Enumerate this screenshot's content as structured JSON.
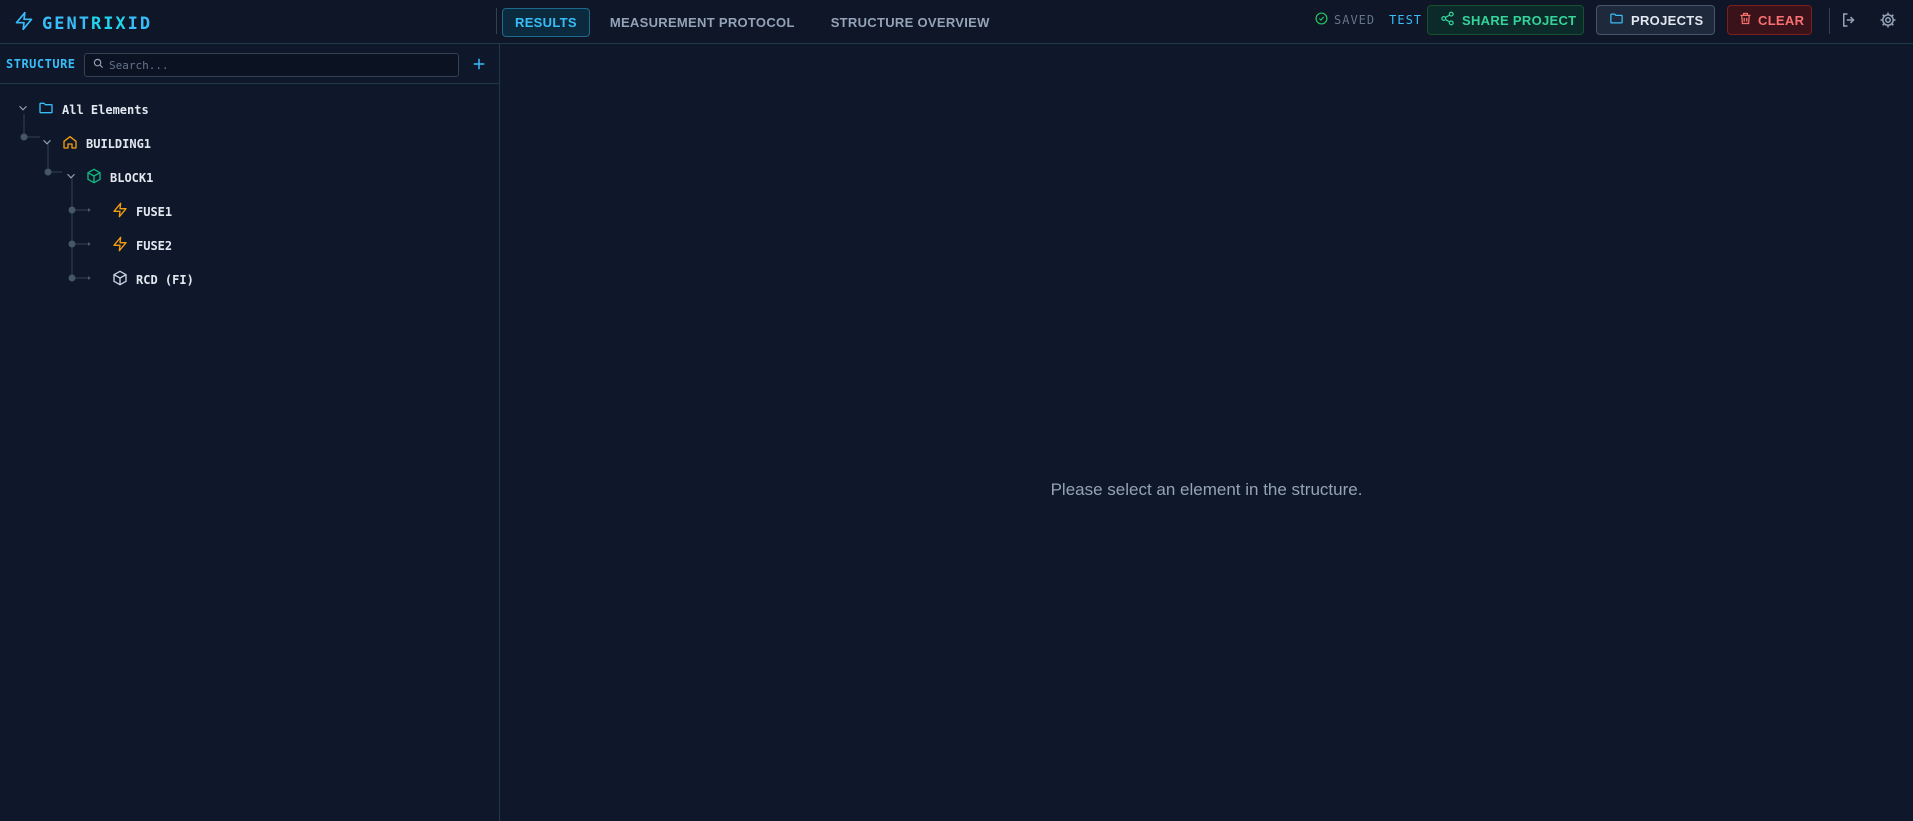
{
  "app": {
    "name_a": "GENT",
    "name_b": "RIX",
    "name_c": "ID"
  },
  "tabs": [
    {
      "label": "RESULTS",
      "active": true
    },
    {
      "label": "MEASUREMENT PROTOCOL",
      "active": false
    },
    {
      "label": "STRUCTURE OVERVIEW",
      "active": false
    }
  ],
  "status": {
    "saved_label": "SAVED",
    "project_name": "TEST"
  },
  "buttons": {
    "share": "SHARE PROJECT",
    "projects": "PROJECTS",
    "clear": "CLEAR"
  },
  "sidebar": {
    "title": "STRUCTURE",
    "search_placeholder": "Search...",
    "tree": [
      {
        "label": "All Elements",
        "icon": "folder-icon"
      },
      {
        "label": "BUILDING1",
        "icon": "house-icon"
      },
      {
        "label": "BLOCK1",
        "icon": "cube-icon"
      },
      {
        "label": "FUSE1",
        "icon": "lightning-icon"
      },
      {
        "label": "FUSE2",
        "icon": "lightning-icon"
      },
      {
        "label": "RCD (FI)",
        "icon": "box-icon"
      }
    ]
  },
  "main": {
    "empty_message": "Please select an element in the structure."
  },
  "colors": {
    "accent": "#38bdf8",
    "success": "#34d399",
    "danger": "#f87171",
    "building": "#f59e0b",
    "block": "#10b981",
    "fuse": "#f59e0b"
  }
}
